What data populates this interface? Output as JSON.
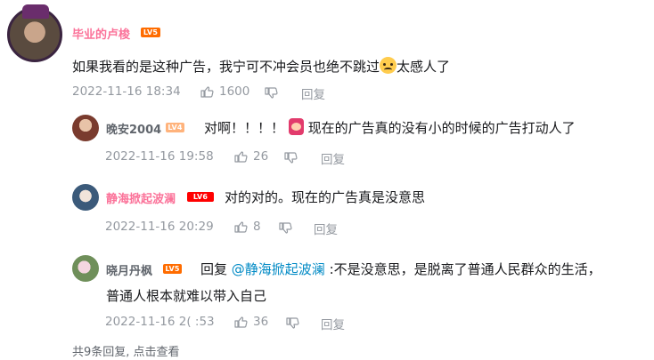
{
  "main_comment": {
    "username": "毕业的卢梭",
    "level": "LV5",
    "text_before": "如果我看的是这种广告，我宁可不冲会员也绝不跳过",
    "emoji": "crying-face-emoji",
    "text_after": "太感人了",
    "time": "2022-11-16 18:34",
    "likes": "1600",
    "reply_label": "回复"
  },
  "replies": [
    {
      "username": "晚安2004",
      "level": "LV4",
      "text_before": "对啊！！！！",
      "emoji": "crying-emote",
      "text_after": "现在的广告真的没有小的时候的广告打动人了",
      "time": "2022-11-16 19:58",
      "likes": "26",
      "reply_label": "回复"
    },
    {
      "username": "静海掀起波澜",
      "level": "LV6",
      "text": "对的对的。现在的广告真是没意思",
      "time": "2022-11-16 20:29",
      "likes": "8",
      "reply_label": "回复"
    },
    {
      "username": "晓月丹枫",
      "level": "LV5",
      "reply_prefix": "回复",
      "mention": "@静海掀起波澜",
      "text_line1": " :不是没意思，是脱离了普通人民群众的生活，",
      "text_line2": "普通人根本就难以带入自己",
      "time": "2022-11-16 2( :53",
      "likes": "36",
      "reply_label": "回复"
    }
  ],
  "footer": {
    "summary": "共9条回复, 点击查看"
  },
  "colors": {
    "pink_name": "#fb7299",
    "level5": "#ff6c00",
    "level4": "#ffb37c",
    "level6": "#ff0000",
    "mention": "#008ac5",
    "meta_gray": "#9499a0"
  }
}
